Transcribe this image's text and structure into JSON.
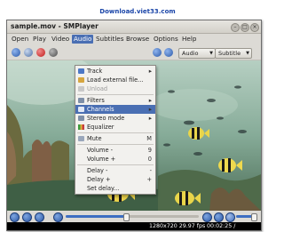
{
  "watermark": "Download.viet33.com",
  "window": {
    "title": "sample.mov - SMPlayer"
  },
  "menubar": [
    "Open",
    "Play",
    "Video",
    "Audio",
    "Subtitles",
    "Browse",
    "Options",
    "Help"
  ],
  "toolbar": {
    "audio_combo": "Audio",
    "subtitle_combo": "Subtitle"
  },
  "audio_menu": [
    {
      "label": "Track",
      "submenu": true,
      "shortcut": "",
      "icon": "speaker-icon"
    },
    {
      "label": "Load external file...",
      "shortcut": "",
      "icon": "folder-icon"
    },
    {
      "label": "Unload",
      "shortcut": "",
      "disabled": true,
      "icon": "unload-icon"
    },
    {
      "label": "Filters",
      "submenu": true,
      "shortcut": "",
      "icon": "filters-icon"
    },
    {
      "label": "Channels",
      "submenu": true,
      "shortcut": "",
      "icon": "channels-icon",
      "highlighted": true
    },
    {
      "label": "Stereo mode",
      "submenu": true,
      "shortcut": "",
      "icon": "stereo-icon"
    },
    {
      "label": "Equalizer",
      "shortcut": "",
      "icon": "equalizer-icon"
    },
    {
      "label": "Mute",
      "shortcut": "M",
      "icon": "mute-icon"
    },
    {
      "label": "Volume -",
      "shortcut": "9",
      "icon": ""
    },
    {
      "label": "Volume +",
      "shortcut": "0",
      "icon": ""
    },
    {
      "label": "Delay -",
      "shortcut": "-",
      "icon": ""
    },
    {
      "label": "Delay +",
      "shortcut": "+",
      "icon": ""
    },
    {
      "label": "Set delay...",
      "shortcut": "",
      "icon": ""
    }
  ],
  "playback": {
    "progress": 0.45,
    "volume": 0.85
  },
  "status": {
    "resolution": "1280x720 29.97 fps",
    "time": "00:02:25 / 00:03:30"
  },
  "colors": {
    "accent": "#4a6fb3",
    "status_bg": "#000000"
  }
}
